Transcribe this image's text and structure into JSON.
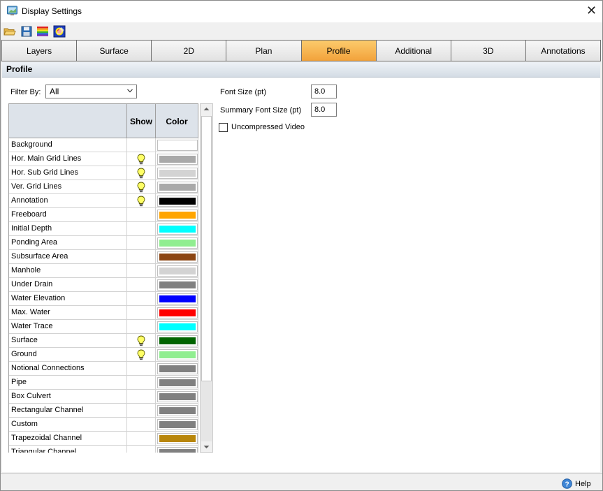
{
  "window": {
    "title": "Display Settings"
  },
  "toolbar": {
    "icons": [
      "open-folder-icon",
      "save-icon",
      "rainbow-palette-icon",
      "color-scheme-icon"
    ]
  },
  "tabs": [
    {
      "label": "Layers",
      "active": false
    },
    {
      "label": "Surface",
      "active": false
    },
    {
      "label": "2D",
      "active": false
    },
    {
      "label": "Plan",
      "active": false
    },
    {
      "label": "Profile",
      "active": true
    },
    {
      "label": "Additional",
      "active": false
    },
    {
      "label": "3D",
      "active": false
    },
    {
      "label": "Annotations",
      "active": false
    }
  ],
  "section": {
    "title": "Profile"
  },
  "filter": {
    "label": "Filter By:",
    "value": "All"
  },
  "grid": {
    "headers": {
      "name": "",
      "show": "Show",
      "color": "Color"
    },
    "rows": [
      {
        "name": "Background",
        "show": false,
        "color": "#ffffff"
      },
      {
        "name": "Hor. Main Grid Lines",
        "show": true,
        "color": "#a9a9a9"
      },
      {
        "name": "Hor. Sub Grid Lines",
        "show": true,
        "color": "#d3d3d3"
      },
      {
        "name": "Ver. Grid Lines",
        "show": true,
        "color": "#a9a9a9"
      },
      {
        "name": "Annotation",
        "show": true,
        "color": "#000000"
      },
      {
        "name": "Freeboard",
        "show": false,
        "color": "#ffa500"
      },
      {
        "name": "Initial Depth",
        "show": false,
        "color": "#00ffff"
      },
      {
        "name": "Ponding Area",
        "show": false,
        "color": "#90ee90"
      },
      {
        "name": "Subsurface Area",
        "show": false,
        "color": "#8b4513"
      },
      {
        "name": "Manhole",
        "show": false,
        "color": "#d3d3d3"
      },
      {
        "name": "Under Drain",
        "show": false,
        "color": "#808080"
      },
      {
        "name": "Water Elevation",
        "show": false,
        "color": "#0000ff"
      },
      {
        "name": "Max. Water",
        "show": false,
        "color": "#ff0000"
      },
      {
        "name": "Water Trace",
        "show": false,
        "color": "#00ffff"
      },
      {
        "name": "Surface",
        "show": true,
        "color": "#006400"
      },
      {
        "name": "Ground",
        "show": true,
        "color": "#90ee90"
      },
      {
        "name": "Notional Connections",
        "show": false,
        "color": "#808080"
      },
      {
        "name": "Pipe",
        "show": false,
        "color": "#808080"
      },
      {
        "name": "Box Culvert",
        "show": false,
        "color": "#808080"
      },
      {
        "name": "Rectangular Channel",
        "show": false,
        "color": "#808080"
      },
      {
        "name": "Custom",
        "show": false,
        "color": "#808080"
      },
      {
        "name": "Trapezoidal Channel",
        "show": false,
        "color": "#b8860b"
      },
      {
        "name": "Triangular Channel",
        "show": false,
        "color": "#808080"
      }
    ]
  },
  "settings": {
    "font_size_label": "Font Size (pt)",
    "font_size_value": "8.0",
    "summary_font_size_label": "Summary Font Size (pt)",
    "summary_font_size_value": "8.0",
    "uncompressed_video_label": "Uncompressed Video",
    "uncompressed_video_checked": false
  },
  "footer": {
    "help_label": "Help"
  },
  "colors": {
    "active_tab": "#f5b04a",
    "header_bg": "#dde3ea",
    "bulb": "#ffff66"
  }
}
